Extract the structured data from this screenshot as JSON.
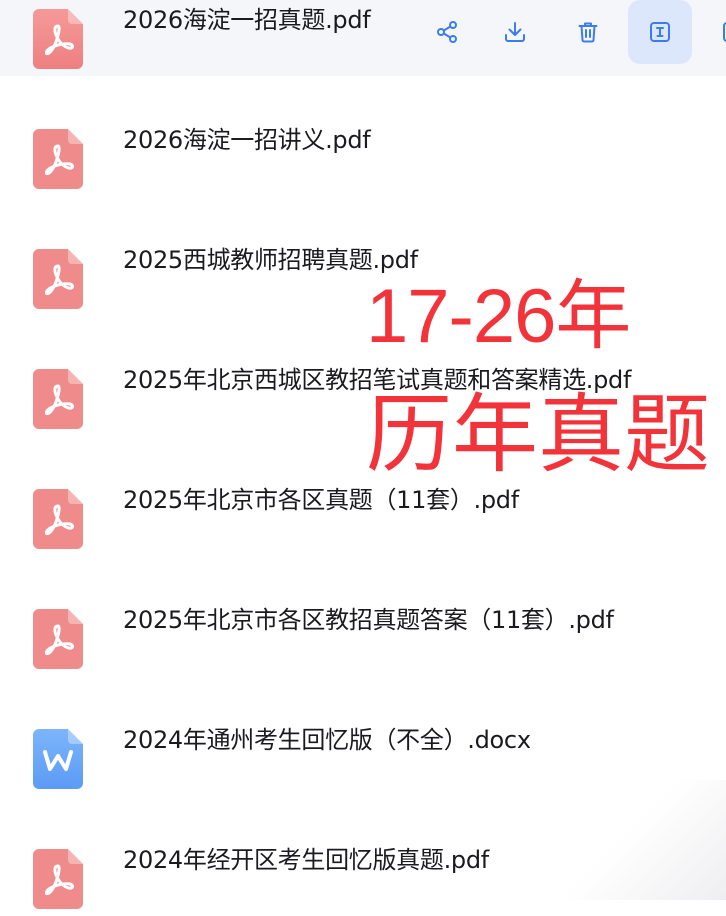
{
  "files": [
    {
      "name": "2026海淀一招真题.pdf",
      "type": "pdf",
      "icon": "pdf-file-icon",
      "selected": true
    },
    {
      "name": "2026海淀一招讲义.pdf",
      "type": "pdf",
      "icon": "pdf-file-icon"
    },
    {
      "name": "2025西城教师招聘真题.pdf",
      "type": "pdf",
      "icon": "pdf-file-icon"
    },
    {
      "name": "2025年北京西城区教招笔试真题和答案精选.pdf",
      "type": "pdf",
      "icon": "pdf-file-icon"
    },
    {
      "name": "2025年北京市各区真题（11套）.pdf",
      "type": "pdf",
      "icon": "pdf-file-icon"
    },
    {
      "name": "2025年北京市各区教招真题答案（11套）.pdf",
      "type": "pdf",
      "icon": "pdf-file-icon"
    },
    {
      "name": "2024年通州考生回忆版（不全）.docx",
      "type": "docx",
      "icon": "word-file-icon"
    },
    {
      "name": "2024年经开区考生回忆版真题.pdf",
      "type": "pdf",
      "icon": "pdf-file-icon"
    }
  ],
  "row_actions": [
    {
      "icon": "share-icon"
    },
    {
      "icon": "download-icon"
    },
    {
      "icon": "trash-icon"
    },
    {
      "icon": "rename-icon",
      "active": true
    },
    {
      "icon": "more-icon"
    }
  ],
  "overlay": {
    "line1": "17-26年",
    "line2": "历年真题"
  },
  "colors": {
    "pdf_icon": "#f08b8b",
    "word_icon": "#6aa7f8",
    "action_icon": "#3b7cf0",
    "overlay_text": "#f2333a",
    "selected_row_bg": "#f4f6fa",
    "active_action_bg": "#dce7fb"
  }
}
